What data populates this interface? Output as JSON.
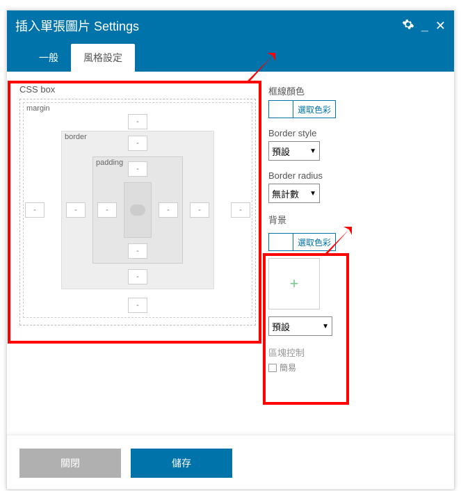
{
  "header": {
    "title": "插入單張圖片 Settings"
  },
  "tabs": {
    "general": "一般",
    "style": "風格設定"
  },
  "cssbox": {
    "title": "CSS box",
    "margin_label": "margin",
    "border_label": "border",
    "padding_label": "padding",
    "dash": "-"
  },
  "right": {
    "border_color_label": "框線顏色",
    "pick_color": "選取色彩",
    "border_style_label": "Border style",
    "border_style_value": "預設",
    "border_radius_label": "Border radius",
    "border_radius_value": "無計數",
    "background_label": "背景",
    "add_icon": "+",
    "bg_select_value": "預設",
    "area_label": "區塊控制",
    "simple_label": "簡易"
  },
  "footer": {
    "close": "關閉",
    "save": "儲存"
  }
}
